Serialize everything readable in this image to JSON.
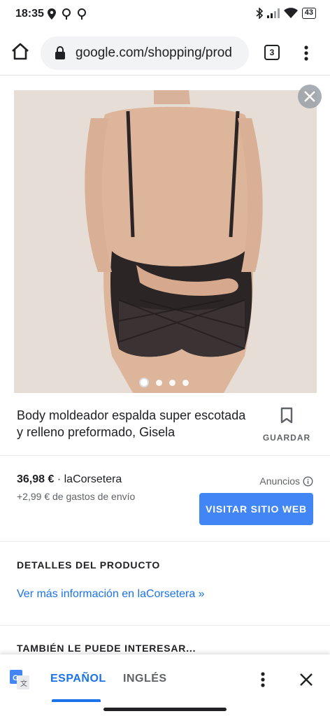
{
  "status_bar": {
    "time": "18:35",
    "battery": "43"
  },
  "browser": {
    "url": "google.com/shopping/prod",
    "tab_count": "3"
  },
  "product": {
    "title": "Body moldeador espalda super escotada y relleno preformado, Gisela",
    "save_label": "GUARDAR",
    "price": "36,98 €",
    "seller_sep": " · laCorsetera",
    "shipping": "+2,99 € de gastos de envío",
    "ads_label": "Anuncios",
    "visit_button": "VISITAR SITIO WEB",
    "image_count": 4,
    "image_index": 1
  },
  "details": {
    "heading": "DETALLES DEL PRODUCTO",
    "more_link": "Ver más información en laCorsetera »"
  },
  "related": {
    "heading": "TAMBIÉN LE PUEDE INTERESAR..."
  },
  "translate_bar": {
    "source_lang": "ESPAÑOL",
    "target_lang": "INGLÉS"
  },
  "colors": {
    "accent": "#1a73e8",
    "button": "#4285f4"
  }
}
